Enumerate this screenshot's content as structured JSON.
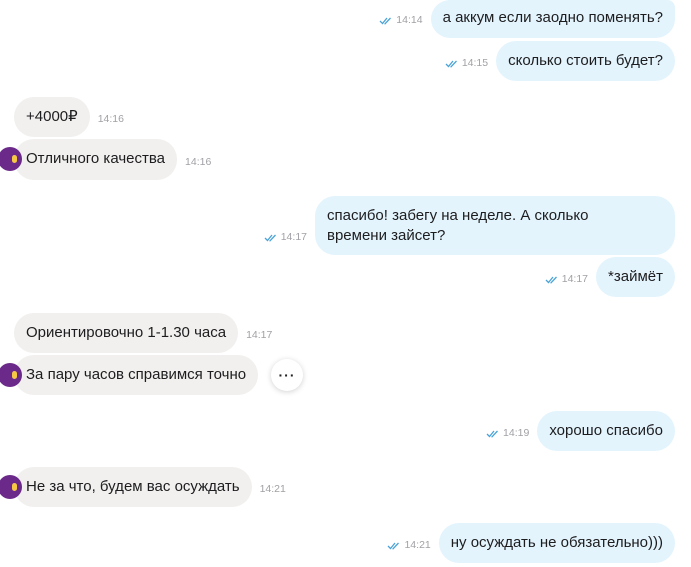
{
  "colors": {
    "outgoing_bubble": "#e3f4fd",
    "incoming_bubble": "#f1f0ee",
    "read_tick": "#4aa3d8",
    "avatar": "#6b2a8a"
  },
  "messages": [
    {
      "dir": "out",
      "text": "а аккум если заодно поменять?",
      "time": "14:14"
    },
    {
      "dir": "out",
      "text": "сколько стоить будет?",
      "time": "14:15"
    },
    {
      "dir": "in",
      "text": "+4000₽",
      "time": "14:16"
    },
    {
      "dir": "in",
      "text": "Отличного качества",
      "time": "14:16"
    },
    {
      "dir": "out",
      "text": "спасибо! забегу на неделе. А сколько\nвремени зайсет?",
      "time": "14:17"
    },
    {
      "dir": "out",
      "text": "*займёт",
      "time": "14:17"
    },
    {
      "dir": "in",
      "text": "Ориентировочно 1-1.30 часа",
      "time": "14:17"
    },
    {
      "dir": "in",
      "text": "За пару часов справимся точно",
      "time": ""
    },
    {
      "dir": "out",
      "text": "хорошо спасибо",
      "time": "14:19"
    },
    {
      "dir": "in",
      "text": "Не за что, будем вас осуждать",
      "time": "14:21"
    },
    {
      "dir": "out",
      "text": "ну осуждать не обязательно)))",
      "time": "14:21"
    }
  ],
  "more_button": {
    "icon": "more-horizontal-icon",
    "label": "···"
  }
}
